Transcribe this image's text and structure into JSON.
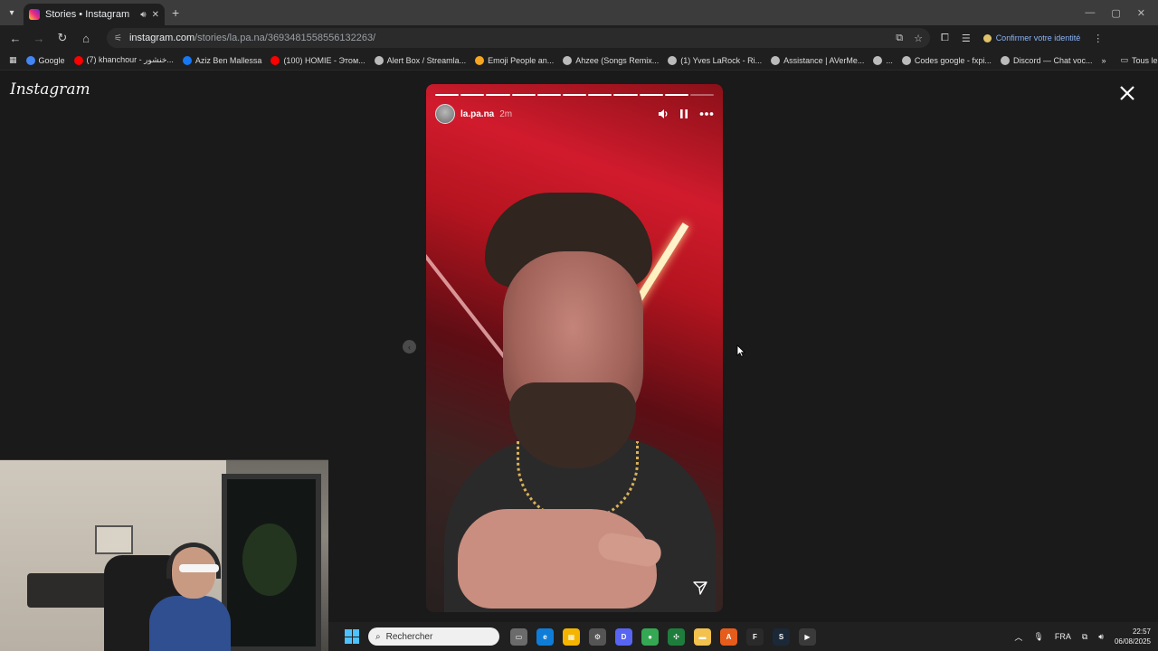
{
  "browser": {
    "tab_title": "Stories • Instagram",
    "url_host": "instagram.com",
    "url_path": "/stories/la.pa.na/3693481558556132263/",
    "identity_label": "Confirmer votre identité",
    "bookmarks": [
      {
        "label": "Google",
        "color": "#4285f4"
      },
      {
        "label": "(7) khanchour - خنشور...",
        "color": "#ff0000"
      },
      {
        "label": "Aziz Ben Mallessa",
        "color": "#1877f2"
      },
      {
        "label": "(100) HOMIE - Этом...",
        "color": "#ff0000"
      },
      {
        "label": "Alert Box / Streamla...",
        "color": "#bbbbbb"
      },
      {
        "label": "Emoji People an...",
        "color": "#f5a623"
      },
      {
        "label": "Ahzee (Songs Remix...",
        "color": "#bbbbbb"
      },
      {
        "label": "(1) Yves LaRock - Ri...",
        "color": "#bbbbbb"
      },
      {
        "label": "Assistance | AVerMe...",
        "color": "#bbbbbb"
      },
      {
        "label": "...",
        "color": "#bbbbbb"
      },
      {
        "label": "Codes google - fxpi...",
        "color": "#bbbbbb"
      },
      {
        "label": "Discord — Chat voc...",
        "color": "#bbbbbb"
      }
    ],
    "all_bookmarks_label": "Tous les favoris"
  },
  "page": {
    "logo": "Instagram",
    "story": {
      "username": "la.pa.na",
      "time_ago": "2m",
      "segments_total": 11,
      "segments_viewed": 10
    }
  },
  "taskbar": {
    "search_placeholder": "Rechercher",
    "language": "FRA",
    "time": "22:57",
    "date": "06/08/2025",
    "apps": [
      {
        "name": "task-view",
        "color": "#6b6b6b",
        "glyph": "▭"
      },
      {
        "name": "edge",
        "color": "#0f7dd8",
        "glyph": "e"
      },
      {
        "name": "store",
        "color": "#f5b400",
        "glyph": "▦"
      },
      {
        "name": "settings",
        "color": "#555555",
        "glyph": "⚙"
      },
      {
        "name": "discord",
        "color": "#5865f2",
        "glyph": "D"
      },
      {
        "name": "chrome",
        "color": "#34a853",
        "glyph": "●"
      },
      {
        "name": "app-green",
        "color": "#1e7d3c",
        "glyph": "✣"
      },
      {
        "name": "file-explorer",
        "color": "#f2c14e",
        "glyph": "▬"
      },
      {
        "name": "app-orange",
        "color": "#e65c1a",
        "glyph": "A"
      },
      {
        "name": "fox-app",
        "color": "#2a2a2a",
        "glyph": "F"
      },
      {
        "name": "steam",
        "color": "#1b2838",
        "glyph": "S"
      },
      {
        "name": "media-player",
        "color": "#3a3a3a",
        "glyph": "▶"
      }
    ]
  }
}
